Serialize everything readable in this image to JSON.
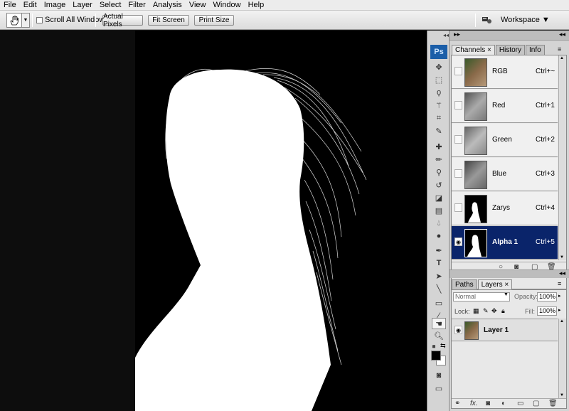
{
  "menu": [
    "File",
    "Edit",
    "Image",
    "Layer",
    "Select",
    "Filter",
    "Analysis",
    "View",
    "Window",
    "Help"
  ],
  "options_bar": {
    "tool_icon": "hand-icon",
    "scroll_all_label": "Scroll All Windows",
    "actual_pixels_label": "Actual Pixels",
    "fit_screen_label": "Fit Screen",
    "print_size_label": "Print Size",
    "workspace_label": "Workspace ▼"
  },
  "toolbox": {
    "ps_logo": "Ps"
  },
  "channels_panel": {
    "tabs": [
      "Channels ×",
      "History",
      "Info"
    ],
    "rows": [
      {
        "name": "RGB",
        "shortcut": "Ctrl+~",
        "visible": false,
        "selected": false
      },
      {
        "name": "Red",
        "shortcut": "Ctrl+1",
        "visible": false,
        "selected": false
      },
      {
        "name": "Green",
        "shortcut": "Ctrl+2",
        "visible": false,
        "selected": false
      },
      {
        "name": "Blue",
        "shortcut": "Ctrl+3",
        "visible": false,
        "selected": false
      },
      {
        "name": "Zarys",
        "shortcut": "Ctrl+4",
        "visible": false,
        "selected": false
      },
      {
        "name": "Alpha 1",
        "shortcut": "Ctrl+5",
        "visible": true,
        "selected": true
      }
    ]
  },
  "layers_panel": {
    "tabs": [
      "Paths",
      "Layers ×"
    ],
    "blend_mode": "Normal",
    "opacity_label": "Opacity:",
    "opacity_value": "100%",
    "lock_label": "Lock:",
    "fill_label": "Fill:",
    "fill_value": "100%",
    "layers": [
      {
        "name": "Layer 1"
      }
    ]
  },
  "colors": {
    "selection": "#0a246a",
    "ps_blue": "#1b5ea8"
  }
}
